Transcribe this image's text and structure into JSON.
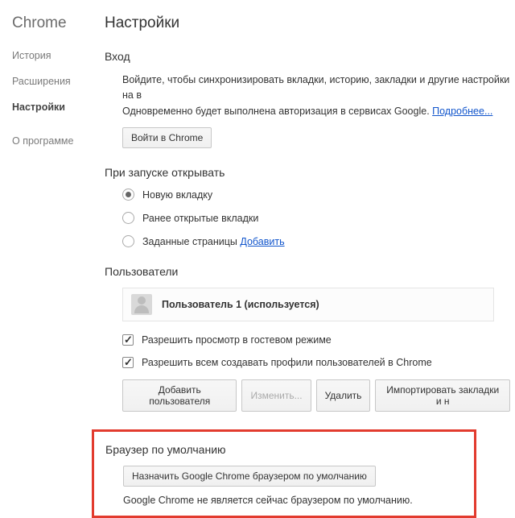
{
  "brand": "Chrome",
  "sidebar": {
    "items": [
      {
        "label": "История"
      },
      {
        "label": "Расширения"
      },
      {
        "label": "Настройки"
      },
      {
        "label": "О программе"
      }
    ],
    "activeIndex": 2
  },
  "pageTitle": "Настройки",
  "signin": {
    "title": "Вход",
    "desc1": "Войдите, чтобы синхронизировать вкладки, историю, закладки и другие настройки на в",
    "desc2": "Одновременно будет выполнена авторизация в сервисах Google. ",
    "learnMore": "Подробнее...",
    "button": "Войти в Chrome"
  },
  "startup": {
    "title": "При запуске открывать",
    "options": [
      {
        "label": "Новую вкладку",
        "checked": true
      },
      {
        "label": "Ранее открытые вкладки",
        "checked": false
      },
      {
        "label": "Заданные страницы",
        "checked": false,
        "link": "Добавить"
      }
    ]
  },
  "users": {
    "title": "Пользователи",
    "current": "Пользователь 1 (используется)",
    "guest": "Разрешить просмотр в гостевом режиме",
    "allowCreate": "Разрешить всем создавать профили пользователей в Chrome",
    "buttons": {
      "add": "Добавить пользователя",
      "edit": "Изменить...",
      "delete": "Удалить",
      "import": "Импортировать закладки и н"
    }
  },
  "defaultBrowser": {
    "title": "Браузер по умолчанию",
    "button": "Назначить Google Chrome браузером по умолчанию",
    "status": "Google Chrome не является сейчас браузером по умолчанию."
  }
}
